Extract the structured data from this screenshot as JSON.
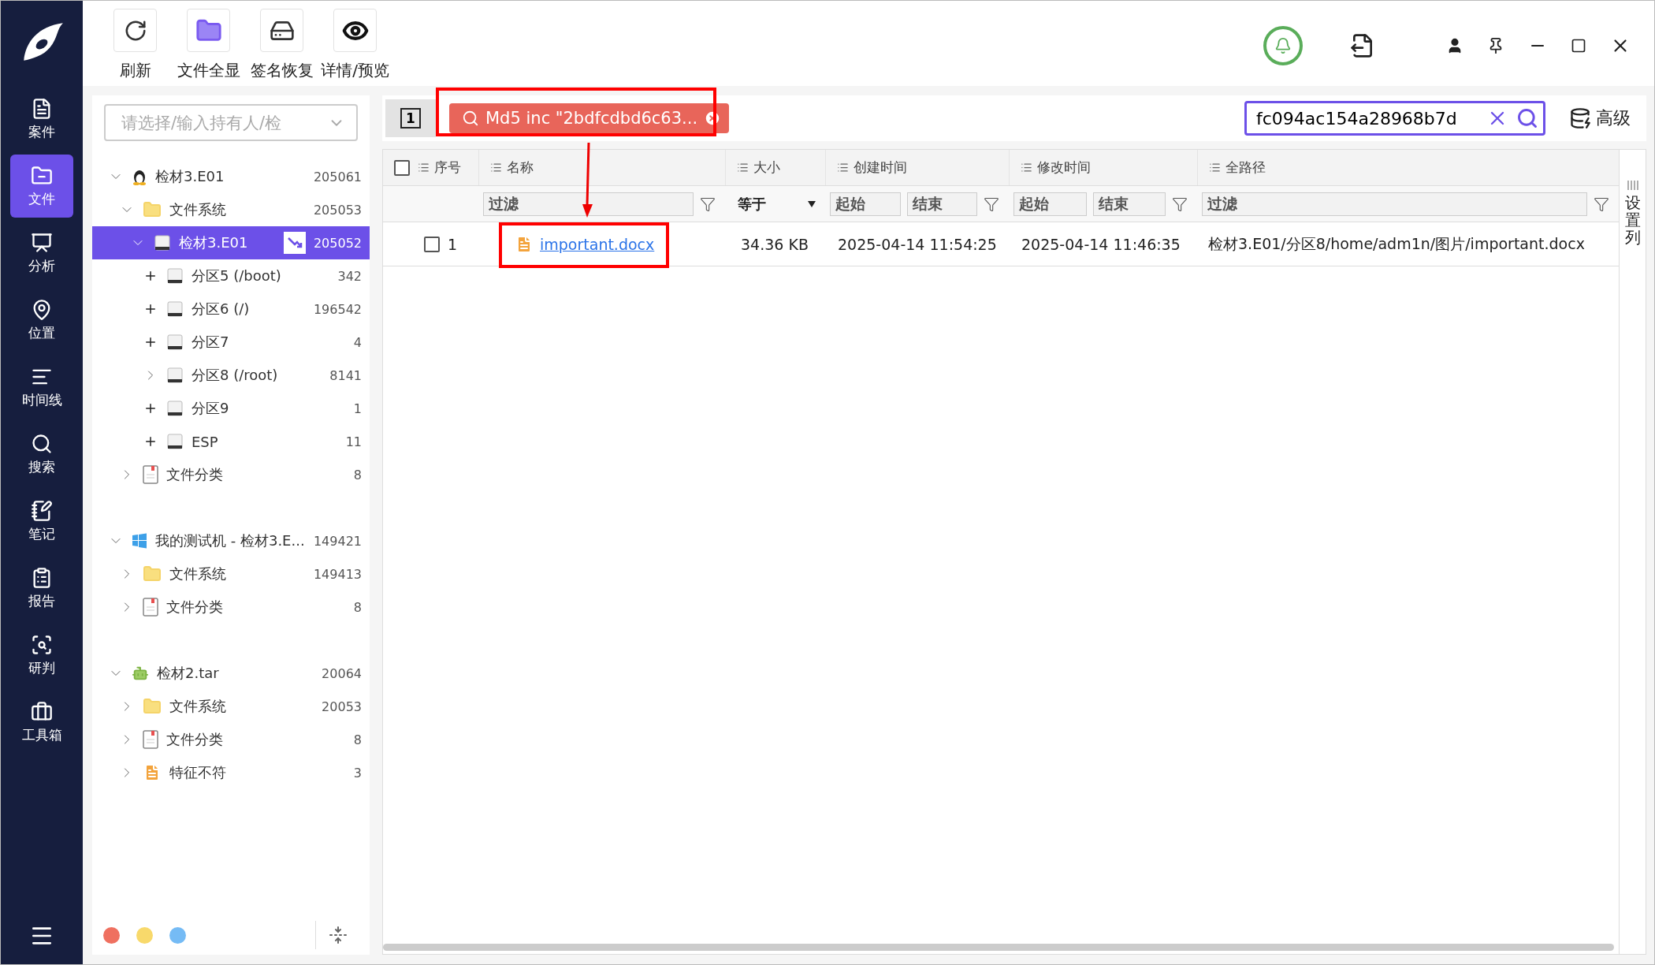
{
  "nav": [
    {
      "label": "案件",
      "selected": false
    },
    {
      "label": "文件",
      "selected": true
    },
    {
      "label": "分析",
      "selected": false
    },
    {
      "label": "位置",
      "selected": false
    },
    {
      "label": "时间线",
      "selected": false
    },
    {
      "label": "搜索",
      "selected": false
    },
    {
      "label": "笔记",
      "selected": false
    },
    {
      "label": "报告",
      "selected": false
    },
    {
      "label": "研判",
      "selected": false
    },
    {
      "label": "工具箱",
      "selected": false
    }
  ],
  "toolbar": [
    {
      "label": "刷新"
    },
    {
      "label": "文件全显"
    },
    {
      "label": "签名恢复"
    },
    {
      "label": "详情/预览"
    }
  ],
  "owner_select": {
    "placeholder": "请选择/输入持有人/检"
  },
  "tree": [
    {
      "kind": "linux",
      "label": "检材3.E01",
      "count": "205061",
      "expanded": true,
      "selected": false,
      "children": [
        {
          "kind": "folder",
          "label": "文件系统",
          "count": "205053",
          "expanded": true,
          "selected": false,
          "children": [
            {
              "kind": "disk",
              "label": "检材3.E01",
              "count": "205052",
              "expanded": true,
              "selected": true,
              "children": [
                {
                  "kind": "disk",
                  "label": "分区5 (/boot)",
                  "count": "342",
                  "expanded": false,
                  "loaded": false,
                  "selected": false
                },
                {
                  "kind": "disk",
                  "label": "分区6 (/)",
                  "count": "196542",
                  "expanded": false,
                  "loaded": false,
                  "selected": false
                },
                {
                  "kind": "disk",
                  "label": "分区7",
                  "count": "4",
                  "expanded": false,
                  "loaded": false,
                  "selected": false
                },
                {
                  "kind": "disk",
                  "label": "分区8 (/root)",
                  "count": "8141",
                  "expanded": false,
                  "loaded": true,
                  "selected": false
                },
                {
                  "kind": "disk",
                  "label": "分区9",
                  "count": "1",
                  "expanded": false,
                  "loaded": false,
                  "selected": false
                },
                {
                  "kind": "disk",
                  "label": "ESP",
                  "count": "11",
                  "expanded": false,
                  "loaded": false,
                  "selected": false
                }
              ]
            }
          ]
        },
        {
          "kind": "category",
          "label": "文件分类",
          "count": "8",
          "expanded": false,
          "selected": false
        }
      ]
    },
    {
      "kind": "windows",
      "label": "我的测试机 - 检材3.E...",
      "count": "149421",
      "expanded": true,
      "selected": false,
      "children": [
        {
          "kind": "folder",
          "label": "文件系统",
          "count": "149413",
          "expanded": false,
          "selected": false
        },
        {
          "kind": "category",
          "label": "文件分类",
          "count": "8",
          "expanded": false,
          "selected": false
        }
      ]
    },
    {
      "kind": "android",
      "label": "检材2.tar",
      "count": "20064",
      "expanded": true,
      "selected": false,
      "children": [
        {
          "kind": "folder",
          "label": "文件系统",
          "count": "20053",
          "expanded": false,
          "selected": false
        },
        {
          "kind": "category",
          "label": "文件分类",
          "count": "8",
          "expanded": false,
          "selected": false
        },
        {
          "kind": "mismatch",
          "label": "特征不符",
          "count": "3",
          "expanded": false,
          "selected": false
        }
      ]
    }
  ],
  "color_dots": [
    {
      "color": "#ef7060"
    },
    {
      "color": "#f8d96b"
    },
    {
      "color": "#75bbf5"
    }
  ],
  "page_button": "1",
  "filter_chip": {
    "text": "Md5 inc \"2bdfcdbd6c63..."
  },
  "search": {
    "value": "fc094ac154a28968b7d"
  },
  "advanced_button": "高级",
  "table": {
    "header_checked": false,
    "columns": [
      {
        "label": "序号"
      },
      {
        "label": "名称"
      },
      {
        "label": "大小"
      },
      {
        "label": "创建时间"
      },
      {
        "label": "修改时间"
      },
      {
        "label": "全路径"
      }
    ],
    "filters": [
      {
        "kind": "none"
      },
      {
        "kind": "text",
        "placeholder": "过滤"
      },
      {
        "kind": "select",
        "value": "等于"
      },
      {
        "kind": "range",
        "from": "起始",
        "to": "结束"
      },
      {
        "kind": "range",
        "from": "起始",
        "to": "结束"
      },
      {
        "kind": "text",
        "placeholder": "过滤"
      }
    ],
    "rows": [
      {
        "checked": false,
        "cells": [
          "1",
          "important.docx",
          "34.36 KB",
          "2025-04-14 11:54:25",
          "2025-04-14 11:46:35",
          "检材3.E01/分区8/home/adm1n/图片/important.docx"
        ]
      }
    ]
  },
  "column_settings": "设置列"
}
